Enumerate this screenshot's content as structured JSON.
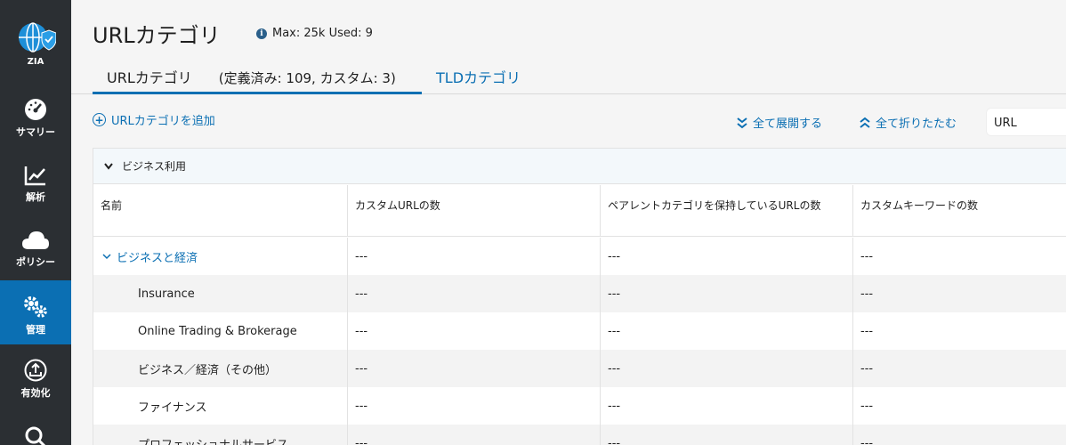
{
  "sidebar": {
    "logo_label": "ZIA",
    "items": [
      {
        "label": "サマリー",
        "icon": "dashboard-icon"
      },
      {
        "label": "解析",
        "icon": "analytics-icon"
      },
      {
        "label": "ポリシー",
        "icon": "cloud-icon"
      },
      {
        "label": "管理",
        "icon": "gears-icon",
        "active": true
      },
      {
        "label": "有効化",
        "icon": "activate-icon"
      },
      {
        "label": "",
        "icon": "search-icon"
      }
    ]
  },
  "header": {
    "title": "URLカテゴリ",
    "quota": "Max: 25k  Used: 9"
  },
  "tabs": {
    "url_categories": "URLカテゴリ",
    "url_count": "(定義済み: 109, カスタム: 3)",
    "tld_categories": "TLDカテゴリ"
  },
  "actions": {
    "add_category": "URLカテゴリを追加",
    "expand_all": "全て展開する",
    "collapse_all": "全て折りたたむ",
    "search_value": "URL"
  },
  "table": {
    "group_title": "ビジネス利用",
    "columns": [
      "名前",
      "カスタムURLの数",
      "ペアレントカテゴリを保持しているURLの数",
      "カスタムキーワードの数"
    ],
    "rows": [
      {
        "name": "ビジネスと経済",
        "custom_urls": "---",
        "parent_urls": "---",
        "keywords": "---",
        "parent": true
      },
      {
        "name": "Insurance",
        "custom_urls": "---",
        "parent_urls": "---",
        "keywords": "---"
      },
      {
        "name": "Online Trading & Brokerage",
        "custom_urls": "---",
        "parent_urls": "---",
        "keywords": "---"
      },
      {
        "name": "ビジネス／経済（その他）",
        "custom_urls": "---",
        "parent_urls": "---",
        "keywords": "---"
      },
      {
        "name": "ファイナンス",
        "custom_urls": "---",
        "parent_urls": "---",
        "keywords": "---"
      },
      {
        "name": "プロフェッショナルサービス",
        "custom_urls": "---",
        "parent_urls": "---",
        "keywords": "---"
      }
    ]
  },
  "colors": {
    "accent": "#0b6fb3",
    "sidebar": "#2b2f33"
  }
}
